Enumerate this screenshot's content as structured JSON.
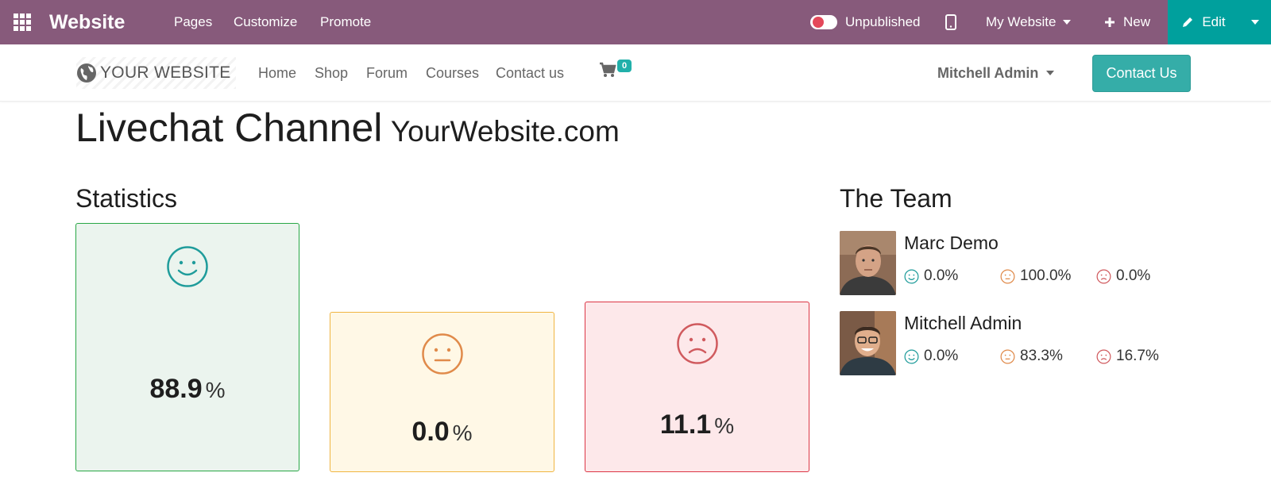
{
  "topbar": {
    "brand": "Website",
    "menu": [
      "Pages",
      "Customize",
      "Promote"
    ],
    "publish_status": "Unpublished",
    "website_selector": "My Website",
    "new_label": "New",
    "edit_label": "Edit"
  },
  "site_header": {
    "logo_text": "YOUR WEBSITE",
    "nav": [
      "Home",
      "Shop",
      "Forum",
      "Courses",
      "Contact us"
    ],
    "cart_count": "0",
    "user_name": "Mitchell Admin",
    "contact_button": "Contact Us"
  },
  "page": {
    "title": "Livechat Channel",
    "subtitle": "YourWebsite.com"
  },
  "statistics": {
    "heading": "Statistics",
    "percent_symbol": "%",
    "happy": "88.9",
    "neutral": "0.0",
    "sad": "11.1"
  },
  "team": {
    "heading": "The Team",
    "members": [
      {
        "name": "Marc Demo",
        "happy": "0.0%",
        "neutral": "100.0%",
        "sad": "0.0%"
      },
      {
        "name": "Mitchell Admin",
        "happy": "0.0%",
        "neutral": "83.3%",
        "sad": "16.7%"
      }
    ]
  },
  "colors": {
    "topbar": "#875a7b",
    "edit": "#00a09d",
    "happy": "#1f9c9b",
    "neutral": "#e08a4a",
    "sad": "#d05a5e"
  },
  "icons": [
    "apps-grid-icon",
    "mobile-icon",
    "plus-icon",
    "pencil-icon",
    "globe-icon",
    "cart-icon",
    "smile-icon",
    "neutral-face-icon",
    "sad-face-icon"
  ]
}
